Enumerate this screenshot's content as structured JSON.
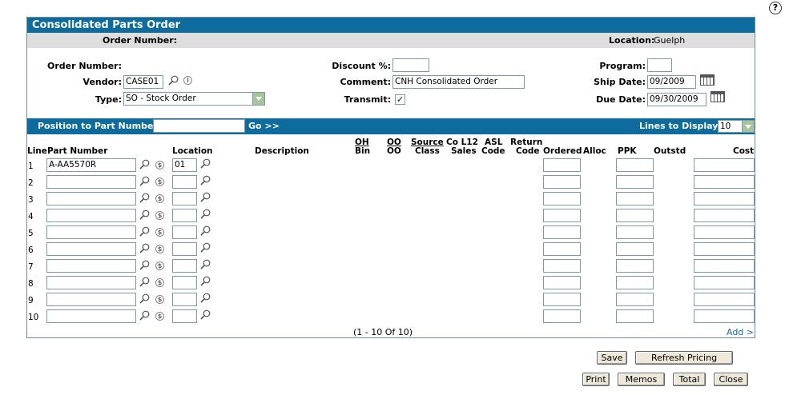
{
  "help_glyph": "?",
  "form": {
    "title": "Consolidated Parts Order",
    "summary": {
      "order_number_label": "Order Number:",
      "location_label": "Location:",
      "location_value": "Guelph"
    },
    "order_number_label": "Order Number:",
    "vendor_label": "Vendor:",
    "vendor_value": "CASE01",
    "type_label": "Type:",
    "type_value": "SO - Stock Order",
    "discount_label": "Discount %:",
    "discount_value": "",
    "comment_label": "Comment:",
    "comment_value": "CNH Consolidated Order",
    "transmit_label": "Transmit:",
    "transmit_checked": "✓",
    "program_label": "Program:",
    "program_value": "",
    "ship_date_label": "Ship Date:",
    "ship_date_value": "09/2009",
    "due_date_label": "Due Date:",
    "due_date_value": "09/30/2009"
  },
  "position_bar": {
    "label": "Position to Part Number:",
    "value": "",
    "go_label": "Go >>",
    "lines_label": "Lines to Display:",
    "lines_value": "10"
  },
  "table": {
    "headers": {
      "line": "Line",
      "part": "Part Number",
      "location": "Location",
      "description": "Description",
      "oh": "OH",
      "bin": "Bin",
      "oo": "OO",
      "oo2": "OO",
      "source": "Source",
      "class": "Class",
      "co": "Co L12",
      "sales": "Sales",
      "asl": "ASL",
      "code": "Code",
      "return": "Return",
      "return_code": "Code",
      "ordered": "Ordered",
      "alloc": "Alloc",
      "ppk": "PPK",
      "outstd": "Outstd",
      "cost": "Cost"
    },
    "rows": [
      {
        "line": "1",
        "part": "A-AA5570R",
        "location": "01"
      },
      {
        "line": "2",
        "part": "",
        "location": ""
      },
      {
        "line": "3",
        "part": "",
        "location": ""
      },
      {
        "line": "4",
        "part": "",
        "location": ""
      },
      {
        "line": "5",
        "part": "",
        "location": ""
      },
      {
        "line": "6",
        "part": "",
        "location": ""
      },
      {
        "line": "7",
        "part": "",
        "location": ""
      },
      {
        "line": "8",
        "part": "",
        "location": ""
      },
      {
        "line": "9",
        "part": "",
        "location": ""
      },
      {
        "line": "10",
        "part": "",
        "location": ""
      }
    ],
    "pagination": "(1 - 10 Of 10)",
    "add_label": "Add >"
  },
  "buttons": {
    "save": "Save",
    "refresh_pricing": "Refresh Pricing",
    "print": "Print",
    "memos": "Memos",
    "total": "Total",
    "close": "Close"
  },
  "colors": {
    "title_bar": "#0d6b9e",
    "subbar": "#dedede",
    "select_button": "#a8c59a",
    "link": "#1565c0"
  }
}
